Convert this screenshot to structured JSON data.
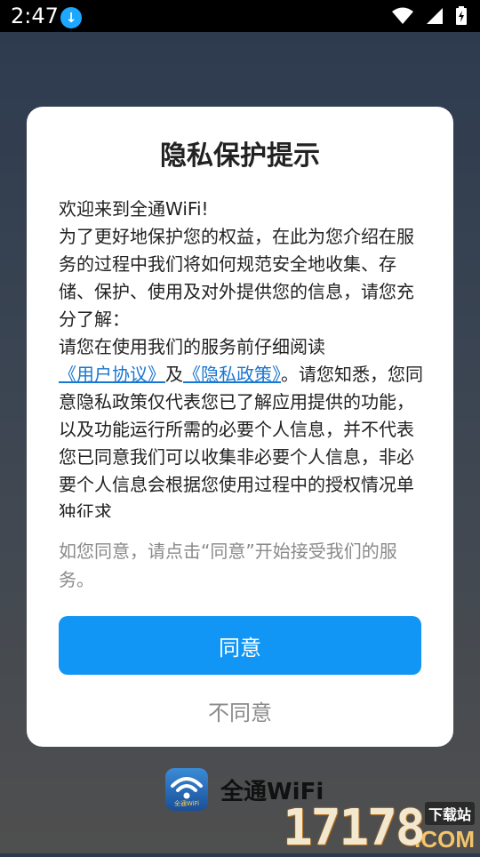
{
  "status_bar": {
    "time": "2:47",
    "icons": [
      "download-icon",
      "wifi-icon",
      "signal-icon",
      "battery-icon"
    ]
  },
  "dialog": {
    "title": "隐私保护提示",
    "welcome": "欢迎来到全通WiFi!",
    "paragraph1": "为了更好地保护您的权益，在此为您介绍在服务的过程中我们将如何规范安全地收集、存储、保护、使用及对外提供您的信息，请您充分了解：",
    "p2_prefix": "请您在使用我们的服务前仔细阅读",
    "user_agreement_link": "《用户协议》",
    "and": "及",
    "privacy_policy_link": "《隐私政策》",
    "p2_suffix": "。请您知悉，您同意隐私政策仅代表您已了解应用提供的功能，以及功能运行所需的必要个人信息，并不代表您已同意我们可以收集非必要个人信息，非必要个人信息会根据您使用过程中的授权情况单独征求",
    "note": "如您同意，请点击“同意”开始接受我们的服务。",
    "agree_label": "同意",
    "disagree_label": "不同意"
  },
  "brand": {
    "logo_text": "全通WiFi",
    "name": "全通WiFi"
  },
  "watermark": {
    "number": "17178",
    "domain": ".COM",
    "site": "下载站"
  },
  "colors": {
    "primary": "#1296f5",
    "link": "#1976d2",
    "muted": "#8a8a8a"
  }
}
